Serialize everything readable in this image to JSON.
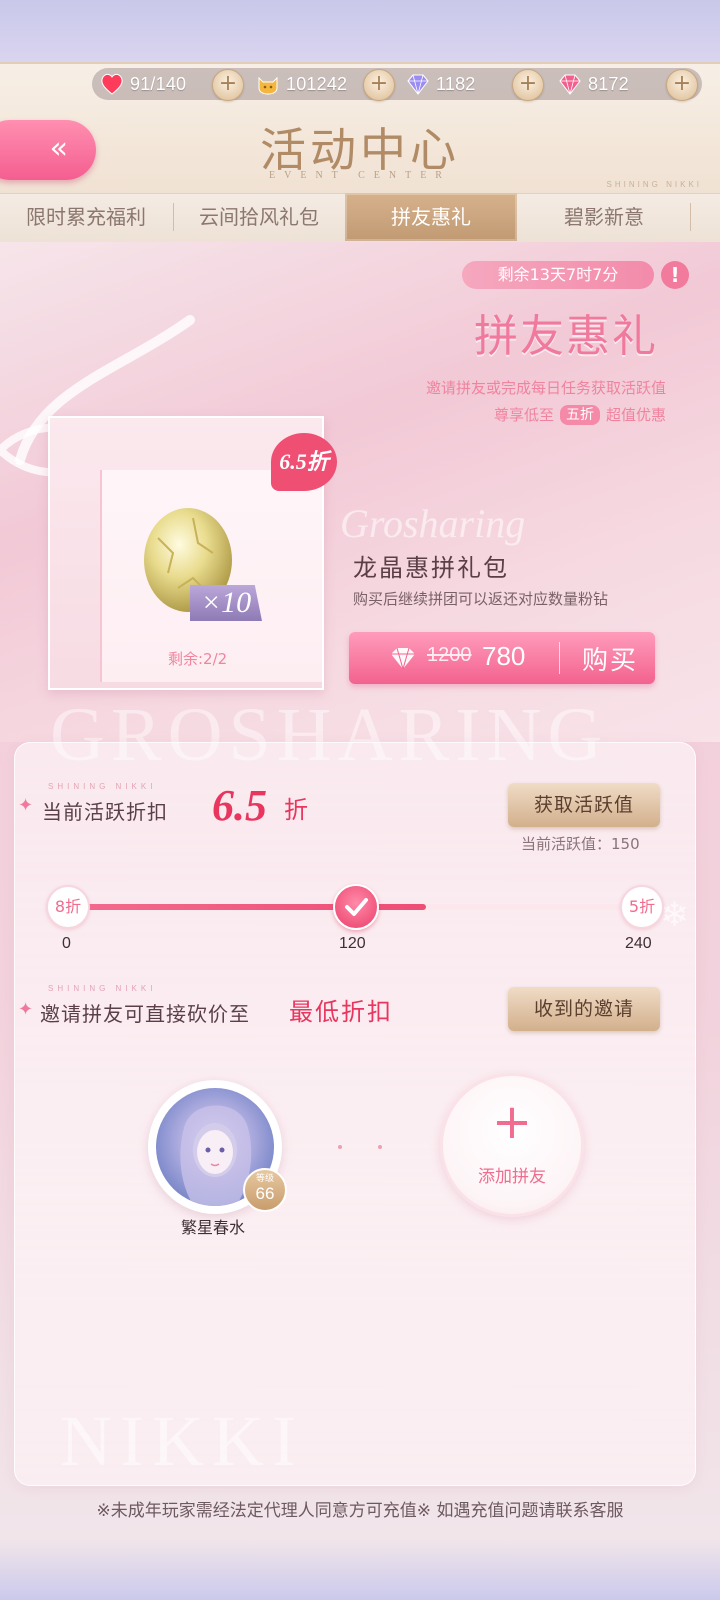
{
  "resources": {
    "stamina": "91/140",
    "gold": "101242",
    "diamond": "1182",
    "pink_diamond": "8172"
  },
  "header": {
    "title": "活动中心",
    "subtitle": "EVENT CENTER",
    "brand": "SHINING NIKKI",
    "back_icon": "double-chevron-left-icon"
  },
  "tabs": [
    {
      "label": "限时累充福利"
    },
    {
      "label": "云间拾风礼包"
    },
    {
      "label": "拼友惠礼",
      "active": true
    },
    {
      "label": "碧影新意"
    }
  ],
  "event": {
    "timer": "剩余13天7时7分",
    "info_icon": "!",
    "title": "拼友惠礼",
    "desc1": "邀请拼友或完成每日任务获取活跃值",
    "desc2_pre": "尊享低至",
    "desc2_pill": "五折",
    "desc2_post": "超值优惠",
    "watermark": "GROSHARING",
    "script_watermark": "Grosharing"
  },
  "pack": {
    "discount_badge": "6.5折",
    "count": "×10",
    "remaining": "剩余:2/2",
    "name": "龙晶惠拼礼包",
    "desc": "购买后继续拼团可以返还对应数量粉钻",
    "old_price": "1200",
    "new_price": "780",
    "buy_label": "购买"
  },
  "activity": {
    "brand": "SHINING NIKKI",
    "label": "当前活跃折扣",
    "discount_value": "6.5",
    "discount_unit": "折",
    "get_button": "获取活跃值",
    "current_value_text": "当前活跃值：150",
    "progress": {
      "min": 0,
      "max": 240,
      "current": 150,
      "start_node": "8折",
      "end_node": "5折",
      "ticks": [
        "0",
        "120",
        "240"
      ]
    }
  },
  "invite": {
    "brand": "SHINING NIKKI",
    "label": "邀请拼友可直接砍价至",
    "highlight": "最低折扣",
    "received_button": "收到的邀请",
    "friend": {
      "name": "繁星春水",
      "level_label": "等级",
      "level": "66"
    },
    "add_friend_label": "添加拼友"
  },
  "bottom_watermark": "NIKKI",
  "footer": "※未成年玩家需经法定代理人同意方可充值※ 如遇充值问题请联系客服",
  "colors": {
    "accent_pink": "#f06d8f",
    "discount_red": "#e8365f",
    "gold": "#c19a73"
  }
}
